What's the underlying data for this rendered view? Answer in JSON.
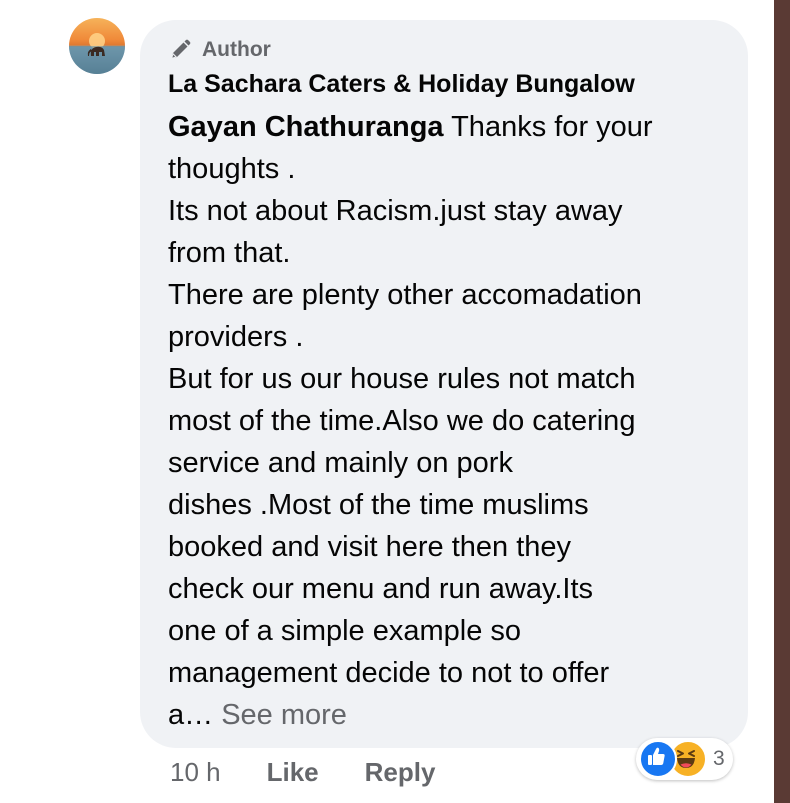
{
  "comment": {
    "author_badge": "Author",
    "commenter_name": "La Sachara Caters & Holiday Bungalow",
    "mention": "Gayan Chathuranga",
    "lines": [
      " Thanks for your",
      "thoughts .",
      "Its not about Racism.just stay away",
      "from that.",
      "There are plenty other accomadation",
      "providers .",
      "But for us our house rules not match",
      "most of the time.Also we do catering",
      "service and mainly on pork",
      "dishes .Most of the time muslims",
      "booked and visit here then they",
      "check our menu and run away.Its",
      "one of a simple example so",
      "management decide to not to offer",
      "a… "
    ],
    "see_more": "See more"
  },
  "actions": {
    "timestamp": "10 h",
    "like_label": "Like",
    "reply_label": "Reply"
  },
  "reactions": {
    "icons": [
      "like-icon",
      "haha-icon"
    ],
    "count": "3"
  },
  "colors": {
    "bubble_bg": "#f0f2f5",
    "muted_text": "#65676b",
    "like_blue": "#1877f2",
    "haha_yellow": "#f7b125"
  }
}
